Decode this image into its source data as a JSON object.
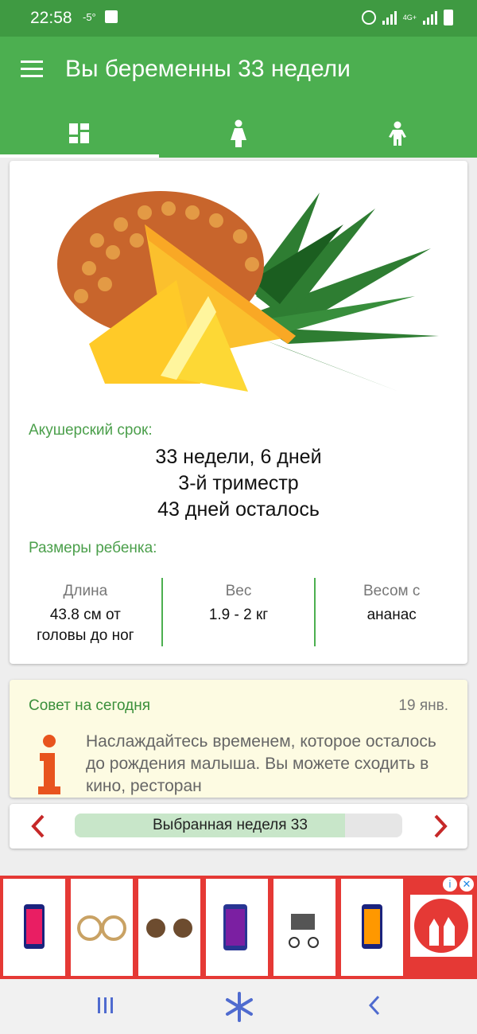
{
  "status": {
    "time": "22:58",
    "temp": "-5°",
    "network": "4G+"
  },
  "appbar": {
    "title": "Вы беременны 33 недели"
  },
  "tabs": [
    {
      "icon": "dashboard-icon"
    },
    {
      "icon": "mother-icon"
    },
    {
      "icon": "baby-icon"
    }
  ],
  "week_card": {
    "fruit_image": "pineapple-image",
    "obstetric_label": "Акушерский срок:",
    "term": "33 недели, 6 дней",
    "trimester": "3-й триместр",
    "remaining": "43 дней осталось",
    "sizes_label": "Размеры ребенка:",
    "length_label": "Длина",
    "length_value": "43.8 см от головы до ног",
    "weight_label": "Вес",
    "weight_value": "1.9 - 2 кг",
    "weight_as_label": "Весом с",
    "weight_as_value": "ананас"
  },
  "tip": {
    "title": "Совет на сегодня",
    "date": "19 янв.",
    "text": "Наслаждайтесь временем, которое осталось до рождения малыша. Вы можете сходить в кино, ресторан"
  },
  "week_selector": {
    "label": "Выбранная неделя 33",
    "progress_fraction": 0.825
  },
  "colors": {
    "primary": "#4caf50",
    "status": "#3f9a42",
    "ad_red": "#e53935",
    "accent_red": "#c62828"
  }
}
